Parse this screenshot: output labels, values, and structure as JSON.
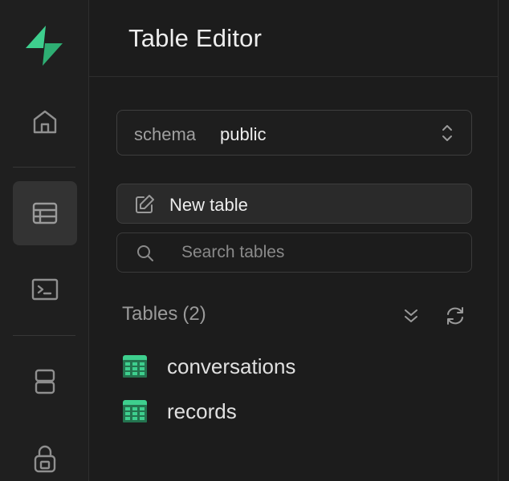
{
  "header": {
    "title": "Table Editor"
  },
  "rail": {
    "items": [
      {
        "icon": "home-icon",
        "active": false
      },
      {
        "icon": "table-icon",
        "active": true
      },
      {
        "icon": "terminal-icon",
        "active": false
      },
      {
        "icon": "database-icon",
        "active": false
      },
      {
        "icon": "lock-icon",
        "active": false
      }
    ]
  },
  "schema": {
    "label": "schema",
    "value": "public"
  },
  "new_table": {
    "label": "New table"
  },
  "search": {
    "placeholder": "Search tables",
    "value": ""
  },
  "tables": {
    "label": "Tables",
    "count_text": "(2)",
    "items": [
      {
        "name": "conversations"
      },
      {
        "name": "records"
      }
    ]
  },
  "colors": {
    "brand": "#3ecf8e",
    "background": "#1c1c1c",
    "text": "#ededed",
    "muted": "#9a9a9a"
  }
}
